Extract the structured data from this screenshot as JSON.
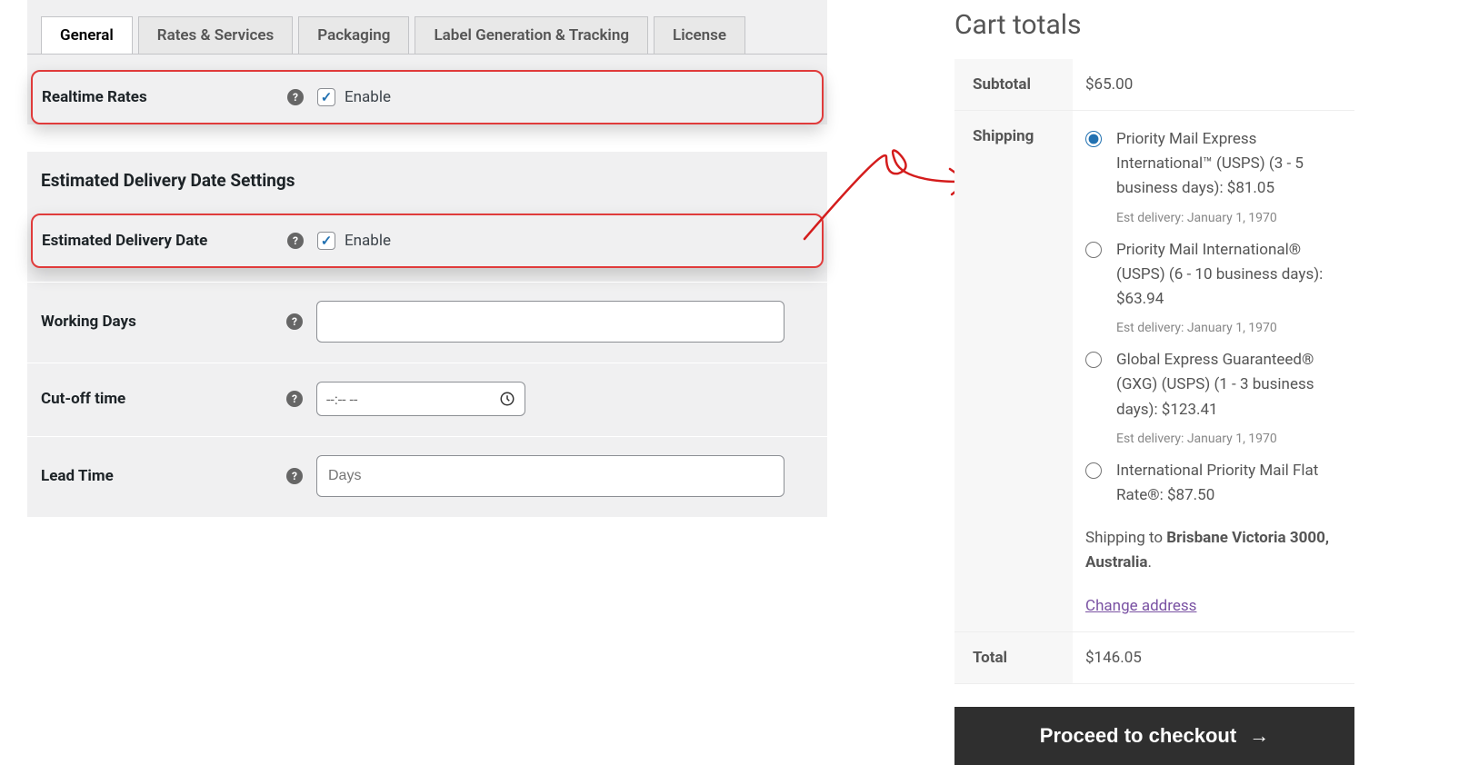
{
  "tabs": {
    "general": "General",
    "rates": "Rates & Services",
    "packaging": "Packaging",
    "label": "Label Generation & Tracking",
    "license": "License"
  },
  "settings": {
    "realtime_rates": {
      "label": "Realtime Rates",
      "enable": "Enable"
    },
    "edd_section_title": "Estimated Delivery Date Settings",
    "estimated_delivery_date": {
      "label": "Estimated Delivery Date",
      "enable": "Enable"
    },
    "working_days": {
      "label": "Working Days"
    },
    "cutoff_time": {
      "label": "Cut-off time",
      "placeholder": "--:-- --"
    },
    "lead_time": {
      "label": "Lead Time",
      "placeholder": "Days"
    }
  },
  "help_icon_text": "?",
  "cart": {
    "title": "Cart totals",
    "subtotal_label": "Subtotal",
    "subtotal_value": "$65.00",
    "shipping_label": "Shipping",
    "total_label": "Total",
    "total_value": "$146.05",
    "shipping_to_prefix": "Shipping to ",
    "shipping_to_address": "Brisbane Victoria 3000, Australia",
    "shipping_to_suffix": ".",
    "change_address": "Change address",
    "checkout_button": "Proceed to checkout",
    "options": [
      {
        "text": "Priority Mail Express International™ (USPS) (3 - 5 business days): $81.05",
        "est": "Est delivery: January 1, 1970",
        "checked": true
      },
      {
        "text": "Priority Mail International® (USPS) (6 - 10 business days): $63.94",
        "est": "Est delivery: January 1, 1970",
        "checked": false
      },
      {
        "text": "Global Express Guaranteed® (GXG) (USPS) (1 - 3 business days): $123.41",
        "est": "Est delivery: January 1, 1970",
        "checked": false
      },
      {
        "text": "International Priority Mail Flat Rate®: $87.50",
        "est": "",
        "checked": false
      }
    ]
  }
}
